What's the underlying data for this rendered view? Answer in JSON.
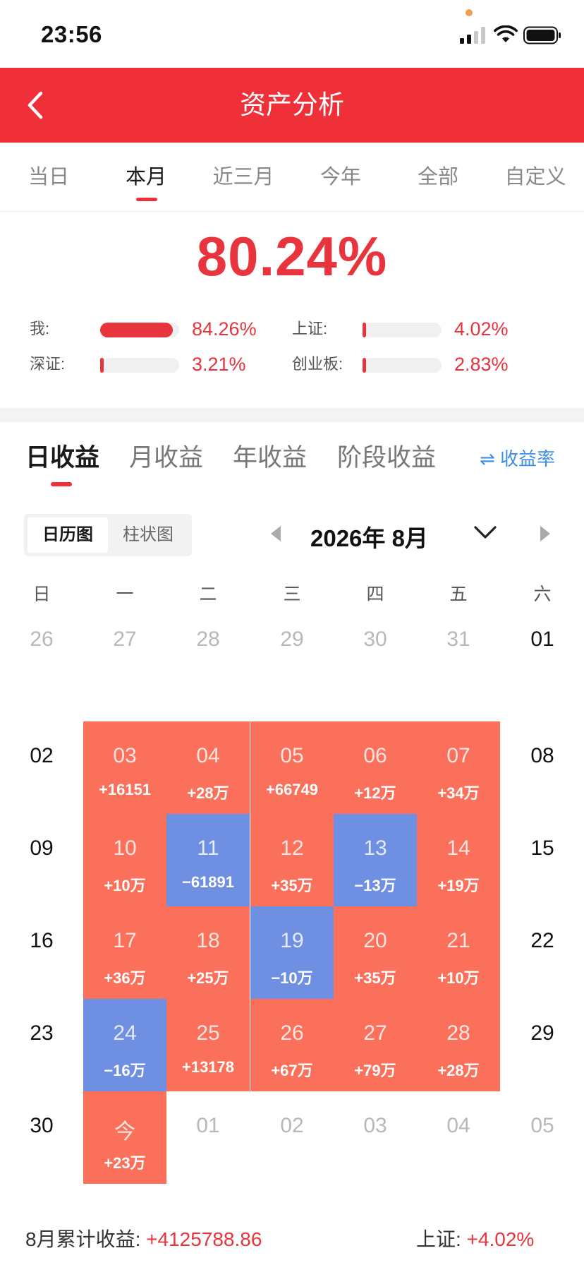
{
  "status": {
    "time": "23:56"
  },
  "header": {
    "title": "资产分析"
  },
  "period_tabs": [
    "当日",
    "本月",
    "近三月",
    "今年",
    "全部",
    "自定义"
  ],
  "period_active": 1,
  "summary": {
    "total_pct": "80.24%",
    "comparisons": [
      {
        "label": "我:",
        "value": "84.26%",
        "fill": 0.92
      },
      {
        "label": "上证:",
        "value": "4.02%",
        "fill": 0.04
      },
      {
        "label": "深证:",
        "value": "3.21%",
        "fill": 0.035
      },
      {
        "label": "创业板:",
        "value": "2.83%",
        "fill": 0.03
      }
    ]
  },
  "earn_tabs": [
    "日收益",
    "月收益",
    "年收益",
    "阶段收益"
  ],
  "rate_link": "⇌ 收益率",
  "view_toggle": [
    "日历图",
    "柱状图"
  ],
  "month_title": "2026年 8月",
  "weekdays": [
    "日",
    "一",
    "二",
    "三",
    "四",
    "五",
    "六"
  ],
  "calendar_rows": [
    [
      {
        "d": "26",
        "m": true
      },
      {
        "d": "27",
        "m": true
      },
      {
        "d": "28",
        "m": true
      },
      {
        "d": "29",
        "m": true
      },
      {
        "d": "30",
        "m": true
      },
      {
        "d": "31",
        "m": true
      },
      {
        "d": "01"
      }
    ],
    [
      {
        "d": "02"
      },
      {
        "d": "03",
        "a": "+16151",
        "t": "pos"
      },
      {
        "d": "04",
        "a": "+28万",
        "t": "pos"
      },
      {
        "d": "05",
        "a": "+66749",
        "t": "pos"
      },
      {
        "d": "06",
        "a": "+12万",
        "t": "pos"
      },
      {
        "d": "07",
        "a": "+34万",
        "t": "pos"
      },
      {
        "d": "08"
      }
    ],
    [
      {
        "d": "09"
      },
      {
        "d": "10",
        "a": "+10万",
        "t": "pos"
      },
      {
        "d": "11",
        "a": "−61891",
        "t": "neg"
      },
      {
        "d": "12",
        "a": "+35万",
        "t": "pos"
      },
      {
        "d": "13",
        "a": "−13万",
        "t": "neg"
      },
      {
        "d": "14",
        "a": "+19万",
        "t": "pos"
      },
      {
        "d": "15"
      }
    ],
    [
      {
        "d": "16"
      },
      {
        "d": "17",
        "a": "+36万",
        "t": "pos"
      },
      {
        "d": "18",
        "a": "+25万",
        "t": "pos"
      },
      {
        "d": "19",
        "a": "−10万",
        "t": "neg"
      },
      {
        "d": "20",
        "a": "+35万",
        "t": "pos"
      },
      {
        "d": "21",
        "a": "+10万",
        "t": "pos"
      },
      {
        "d": "22"
      }
    ],
    [
      {
        "d": "23"
      },
      {
        "d": "24",
        "a": "−16万",
        "t": "neg"
      },
      {
        "d": "25",
        "a": "+13178",
        "t": "pos"
      },
      {
        "d": "26",
        "a": "+67万",
        "t": "pos"
      },
      {
        "d": "27",
        "a": "+79万",
        "t": "pos"
      },
      {
        "d": "28",
        "a": "+28万",
        "t": "pos"
      },
      {
        "d": "29"
      }
    ],
    [
      {
        "d": "30"
      },
      {
        "d": "今",
        "a": "+23万",
        "t": "pos"
      },
      {
        "d": "01",
        "m": true
      },
      {
        "d": "02",
        "m": true
      },
      {
        "d": "03",
        "m": true
      },
      {
        "d": "04",
        "m": true
      },
      {
        "d": "05",
        "m": true
      }
    ]
  ],
  "footer": {
    "cumulative_label": "8月累计收益:",
    "cumulative_value": "+4125788.86",
    "index_label": "上证:",
    "index_value": "+4.02%"
  },
  "colors": {
    "brand_red": "#ef3039",
    "gain": "#fa705b",
    "loss": "#6f8fe3",
    "link": "#3d8ee6"
  }
}
